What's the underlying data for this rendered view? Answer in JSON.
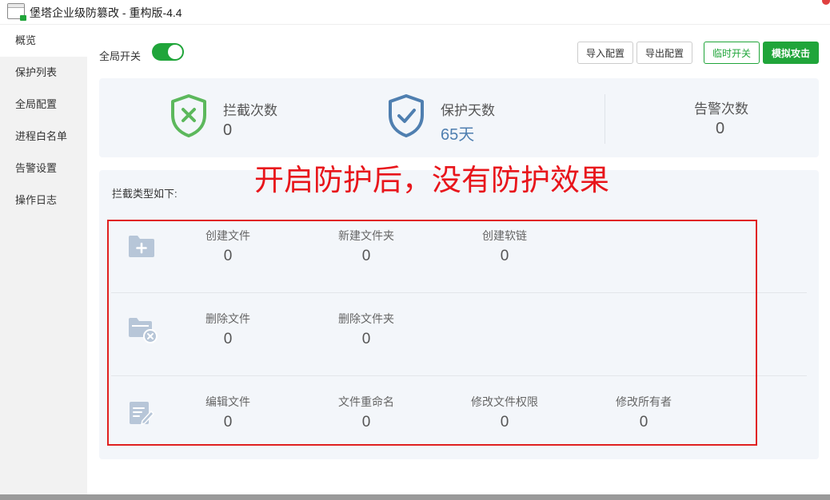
{
  "window": {
    "title": "堡塔企业级防篡改 - 重构版-4.4"
  },
  "sidebar": {
    "items": [
      {
        "label": "概览"
      },
      {
        "label": "保护列表"
      },
      {
        "label": "全局配置"
      },
      {
        "label": "进程白名单"
      },
      {
        "label": "告警设置"
      },
      {
        "label": "操作日志"
      }
    ]
  },
  "toolbar": {
    "global_switch_label": "全局开关",
    "import_label": "导入配置",
    "export_label": "导出配置",
    "temp_switch_label": "临时开关",
    "simulate_label": "模拟攻击"
  },
  "overview": {
    "blocked": {
      "label": "拦截次数",
      "value": "0"
    },
    "protected_days": {
      "label": "保护天数",
      "value": "65天"
    },
    "alerts": {
      "label": "告警次数",
      "value": "0"
    }
  },
  "annotation": "开启防护后，没有防护效果",
  "intercept": {
    "title": "拦截类型如下:",
    "rows": [
      {
        "icon": "folder-add-icon",
        "items": [
          {
            "label": "创建文件",
            "value": "0"
          },
          {
            "label": "新建文件夹",
            "value": "0"
          },
          {
            "label": "创建软链",
            "value": "0"
          }
        ]
      },
      {
        "icon": "folder-delete-icon",
        "items": [
          {
            "label": "删除文件",
            "value": "0"
          },
          {
            "label": "删除文件夹",
            "value": "0"
          }
        ]
      },
      {
        "icon": "edit-file-icon",
        "items": [
          {
            "label": "编辑文件",
            "value": "0"
          },
          {
            "label": "文件重命名",
            "value": "0"
          },
          {
            "label": "修改文件权限",
            "value": "0"
          },
          {
            "label": "修改所有者",
            "value": "0"
          }
        ]
      }
    ]
  },
  "colors": {
    "accent": "#20a53a",
    "shield_green": "#5cb85c",
    "shield_blue": "#4f7fb0",
    "annotation_red": "#e8151b",
    "icon_gray": "#b7c6d8"
  }
}
